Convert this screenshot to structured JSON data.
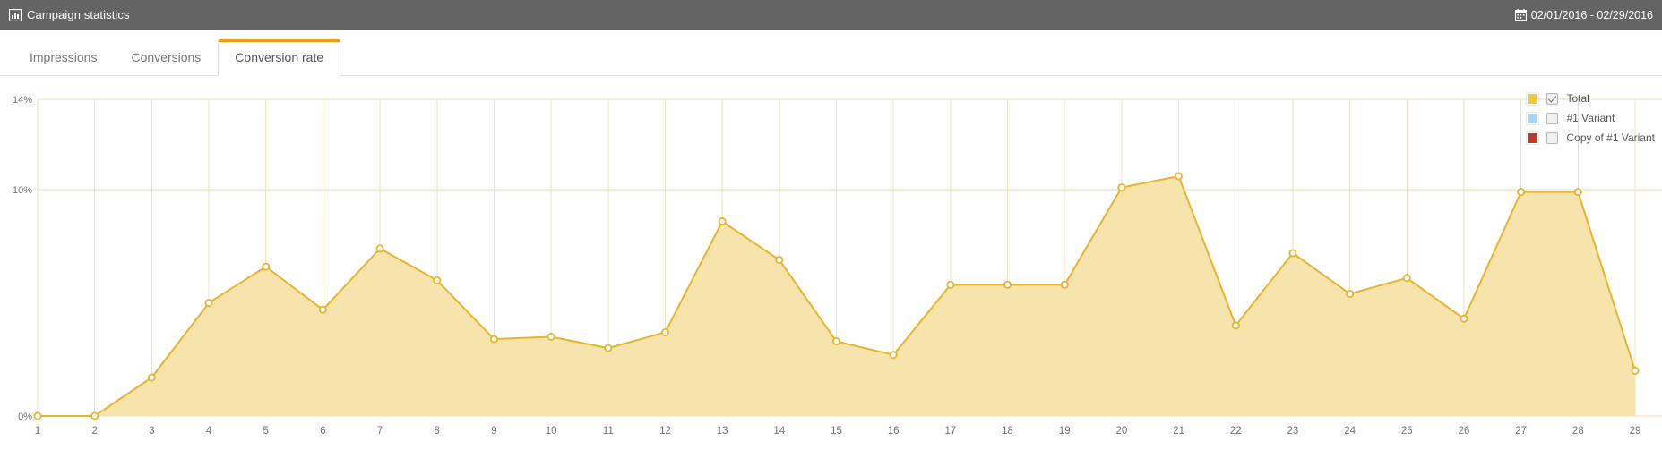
{
  "topbar": {
    "title": "Campaign statistics",
    "title_icon": "bar-chart-icon",
    "date_range": "02/01/2016 - 02/29/2016",
    "date_icon": "calendar-icon",
    "background": "#646464"
  },
  "tabs": [
    {
      "label": "Impressions",
      "active": false
    },
    {
      "label": "Conversions",
      "active": false
    },
    {
      "label": "Conversion rate",
      "active": true
    }
  ],
  "legend": {
    "items": [
      {
        "label": "Total",
        "color": "#f2c841",
        "checked": true
      },
      {
        "label": "#1 Variant",
        "color": "#a7d4f2",
        "checked": false
      },
      {
        "label": "Copy of #1 Variant",
        "color": "#c0392b",
        "checked": false
      }
    ]
  },
  "chart_data": {
    "type": "area",
    "title": "Conversion rate",
    "xlabel": "",
    "ylabel": "",
    "ylim": [
      0,
      14
    ],
    "yticks": [
      0,
      10,
      14
    ],
    "ytick_labels": [
      "0%",
      "10%",
      "14%"
    ],
    "grid": true,
    "legend_position": "top-right",
    "line_color": "#e5b52d",
    "fill_color": "#f7e3ac",
    "marker_fill": "#ffffff",
    "categories": [
      1,
      2,
      3,
      4,
      5,
      6,
      7,
      8,
      9,
      10,
      11,
      12,
      13,
      14,
      15,
      16,
      17,
      18,
      19,
      20,
      21,
      22,
      23,
      24,
      25,
      26,
      27,
      28,
      29
    ],
    "series": [
      {
        "name": "Total",
        "values": [
          0,
          0,
          1.7,
          5.0,
          6.6,
          4.7,
          7.4,
          6.0,
          3.4,
          3.5,
          3.0,
          3.7,
          8.6,
          6.9,
          3.3,
          2.7,
          5.8,
          5.8,
          5.8,
          10.1,
          10.6,
          4.0,
          7.2,
          5.4,
          6.1,
          4.3,
          9.9,
          9.9,
          2.0
        ]
      }
    ]
  }
}
